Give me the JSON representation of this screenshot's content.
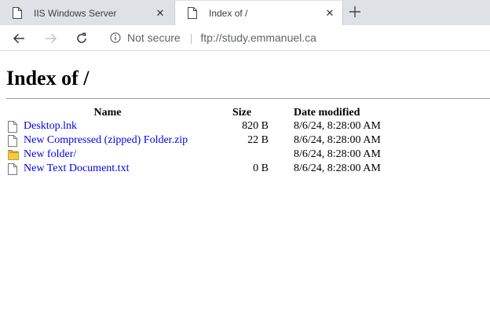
{
  "browser": {
    "tabs": [
      {
        "title": "IIS Windows Server",
        "active": false
      },
      {
        "title": "Index of /",
        "active": true
      }
    ],
    "close_glyph": "✕",
    "security_label": "Not secure",
    "url": "ftp://study.emmanuel.ca"
  },
  "page": {
    "heading": "Index of /",
    "columns": {
      "name": "Name",
      "size": "Size",
      "date": "Date modified"
    },
    "entries": [
      {
        "name": "Desktop.lnk",
        "size": "820 B",
        "date": "8/6/24, 8:28:00 AM",
        "icon": "file-icon"
      },
      {
        "name": "New Compressed (zipped) Folder.zip",
        "size": "22 B",
        "date": "8/6/24, 8:28:00 AM",
        "icon": "file-icon"
      },
      {
        "name": "New folder/",
        "size": "",
        "date": "8/6/24, 8:28:00 AM",
        "icon": "folder-icon"
      },
      {
        "name": "New Text Document.txt",
        "size": "0 B",
        "date": "8/6/24, 8:28:00 AM",
        "icon": "file-icon"
      }
    ],
    "link_color": "#0000ee",
    "folder_color": "#e8b935"
  }
}
